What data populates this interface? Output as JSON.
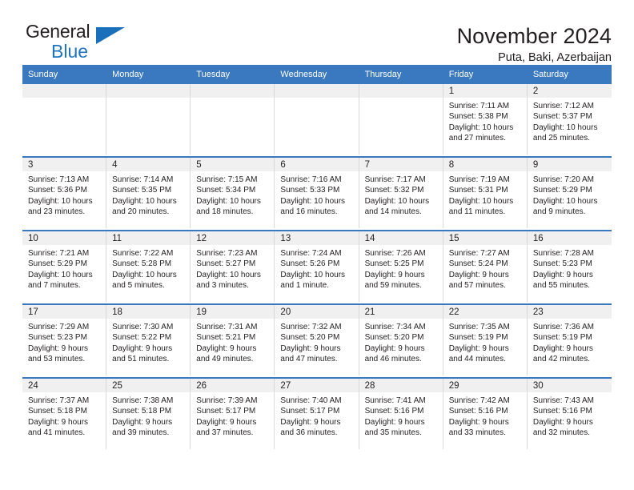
{
  "brand": {
    "name_part1": "General",
    "name_part2": "Blue",
    "logo_icon": "triangle-flag-icon"
  },
  "header": {
    "title": "November 2024",
    "location": "Puta, Baki, Azerbaijan"
  },
  "calendar": {
    "weekday_headers": [
      "Sunday",
      "Monday",
      "Tuesday",
      "Wednesday",
      "Thursday",
      "Friday",
      "Saturday"
    ],
    "accent_color": "#3a78bf",
    "daynum_band_color": "#f0f0f0",
    "weeks": [
      [
        {
          "day": "",
          "lines": []
        },
        {
          "day": "",
          "lines": []
        },
        {
          "day": "",
          "lines": []
        },
        {
          "day": "",
          "lines": []
        },
        {
          "day": "",
          "lines": []
        },
        {
          "day": "1",
          "lines": [
            "Sunrise: 7:11 AM",
            "Sunset: 5:38 PM",
            "Daylight: 10 hours",
            "and 27 minutes."
          ]
        },
        {
          "day": "2",
          "lines": [
            "Sunrise: 7:12 AM",
            "Sunset: 5:37 PM",
            "Daylight: 10 hours",
            "and 25 minutes."
          ]
        }
      ],
      [
        {
          "day": "3",
          "lines": [
            "Sunrise: 7:13 AM",
            "Sunset: 5:36 PM",
            "Daylight: 10 hours",
            "and 23 minutes."
          ]
        },
        {
          "day": "4",
          "lines": [
            "Sunrise: 7:14 AM",
            "Sunset: 5:35 PM",
            "Daylight: 10 hours",
            "and 20 minutes."
          ]
        },
        {
          "day": "5",
          "lines": [
            "Sunrise: 7:15 AM",
            "Sunset: 5:34 PM",
            "Daylight: 10 hours",
            "and 18 minutes."
          ]
        },
        {
          "day": "6",
          "lines": [
            "Sunrise: 7:16 AM",
            "Sunset: 5:33 PM",
            "Daylight: 10 hours",
            "and 16 minutes."
          ]
        },
        {
          "day": "7",
          "lines": [
            "Sunrise: 7:17 AM",
            "Sunset: 5:32 PM",
            "Daylight: 10 hours",
            "and 14 minutes."
          ]
        },
        {
          "day": "8",
          "lines": [
            "Sunrise: 7:19 AM",
            "Sunset: 5:31 PM",
            "Daylight: 10 hours",
            "and 11 minutes."
          ]
        },
        {
          "day": "9",
          "lines": [
            "Sunrise: 7:20 AM",
            "Sunset: 5:29 PM",
            "Daylight: 10 hours",
            "and 9 minutes."
          ]
        }
      ],
      [
        {
          "day": "10",
          "lines": [
            "Sunrise: 7:21 AM",
            "Sunset: 5:29 PM",
            "Daylight: 10 hours",
            "and 7 minutes."
          ]
        },
        {
          "day": "11",
          "lines": [
            "Sunrise: 7:22 AM",
            "Sunset: 5:28 PM",
            "Daylight: 10 hours",
            "and 5 minutes."
          ]
        },
        {
          "day": "12",
          "lines": [
            "Sunrise: 7:23 AM",
            "Sunset: 5:27 PM",
            "Daylight: 10 hours",
            "and 3 minutes."
          ]
        },
        {
          "day": "13",
          "lines": [
            "Sunrise: 7:24 AM",
            "Sunset: 5:26 PM",
            "Daylight: 10 hours",
            "and 1 minute."
          ]
        },
        {
          "day": "14",
          "lines": [
            "Sunrise: 7:26 AM",
            "Sunset: 5:25 PM",
            "Daylight: 9 hours",
            "and 59 minutes."
          ]
        },
        {
          "day": "15",
          "lines": [
            "Sunrise: 7:27 AM",
            "Sunset: 5:24 PM",
            "Daylight: 9 hours",
            "and 57 minutes."
          ]
        },
        {
          "day": "16",
          "lines": [
            "Sunrise: 7:28 AM",
            "Sunset: 5:23 PM",
            "Daylight: 9 hours",
            "and 55 minutes."
          ]
        }
      ],
      [
        {
          "day": "17",
          "lines": [
            "Sunrise: 7:29 AM",
            "Sunset: 5:23 PM",
            "Daylight: 9 hours",
            "and 53 minutes."
          ]
        },
        {
          "day": "18",
          "lines": [
            "Sunrise: 7:30 AM",
            "Sunset: 5:22 PM",
            "Daylight: 9 hours",
            "and 51 minutes."
          ]
        },
        {
          "day": "19",
          "lines": [
            "Sunrise: 7:31 AM",
            "Sunset: 5:21 PM",
            "Daylight: 9 hours",
            "and 49 minutes."
          ]
        },
        {
          "day": "20",
          "lines": [
            "Sunrise: 7:32 AM",
            "Sunset: 5:20 PM",
            "Daylight: 9 hours",
            "and 47 minutes."
          ]
        },
        {
          "day": "21",
          "lines": [
            "Sunrise: 7:34 AM",
            "Sunset: 5:20 PM",
            "Daylight: 9 hours",
            "and 46 minutes."
          ]
        },
        {
          "day": "22",
          "lines": [
            "Sunrise: 7:35 AM",
            "Sunset: 5:19 PM",
            "Daylight: 9 hours",
            "and 44 minutes."
          ]
        },
        {
          "day": "23",
          "lines": [
            "Sunrise: 7:36 AM",
            "Sunset: 5:19 PM",
            "Daylight: 9 hours",
            "and 42 minutes."
          ]
        }
      ],
      [
        {
          "day": "24",
          "lines": [
            "Sunrise: 7:37 AM",
            "Sunset: 5:18 PM",
            "Daylight: 9 hours",
            "and 41 minutes."
          ]
        },
        {
          "day": "25",
          "lines": [
            "Sunrise: 7:38 AM",
            "Sunset: 5:18 PM",
            "Daylight: 9 hours",
            "and 39 minutes."
          ]
        },
        {
          "day": "26",
          "lines": [
            "Sunrise: 7:39 AM",
            "Sunset: 5:17 PM",
            "Daylight: 9 hours",
            "and 37 minutes."
          ]
        },
        {
          "day": "27",
          "lines": [
            "Sunrise: 7:40 AM",
            "Sunset: 5:17 PM",
            "Daylight: 9 hours",
            "and 36 minutes."
          ]
        },
        {
          "day": "28",
          "lines": [
            "Sunrise: 7:41 AM",
            "Sunset: 5:16 PM",
            "Daylight: 9 hours",
            "and 35 minutes."
          ]
        },
        {
          "day": "29",
          "lines": [
            "Sunrise: 7:42 AM",
            "Sunset: 5:16 PM",
            "Daylight: 9 hours",
            "and 33 minutes."
          ]
        },
        {
          "day": "30",
          "lines": [
            "Sunrise: 7:43 AM",
            "Sunset: 5:16 PM",
            "Daylight: 9 hours",
            "and 32 minutes."
          ]
        }
      ]
    ]
  }
}
